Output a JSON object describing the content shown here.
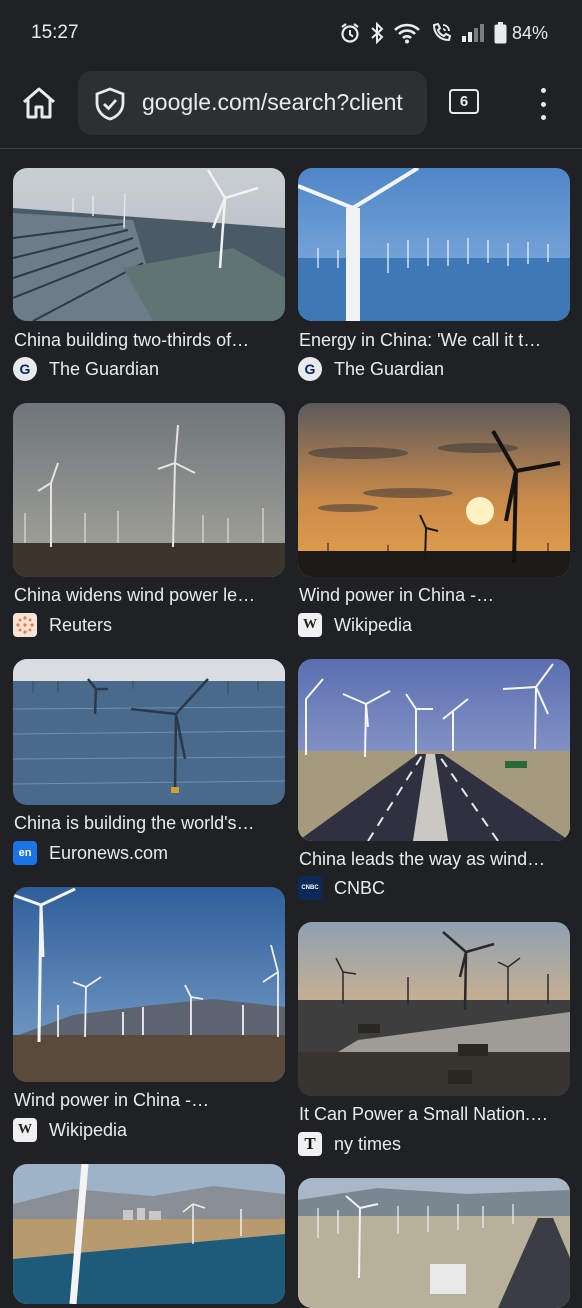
{
  "status": {
    "time": "15:27",
    "battery": "84%"
  },
  "toolbar": {
    "url": "google.com/search?client",
    "tab_count": "6"
  },
  "results": [
    {
      "title": "China building two-thirds of…",
      "source": "The Guardian",
      "logo_letter": "G"
    },
    {
      "title": "Energy in China: 'We call it t…",
      "source": "The Guardian",
      "logo_letter": "G"
    },
    {
      "title": "China widens wind power le…",
      "source": "Reuters",
      "logo_letter": ""
    },
    {
      "title": "Wind power in China -…",
      "source": "Wikipedia",
      "logo_letter": "W"
    },
    {
      "title": "China is building the world's…",
      "source": "Euronews.com",
      "logo_letter": "en"
    },
    {
      "title": "China leads the way as wind…",
      "source": "CNBC",
      "logo_letter": "CNBC"
    },
    {
      "title": "Wind power in China -…",
      "source": "Wikipedia",
      "logo_letter": "W"
    },
    {
      "title": "It Can Power a Small Nation.…",
      "source": "ny times",
      "logo_letter": "T"
    }
  ]
}
